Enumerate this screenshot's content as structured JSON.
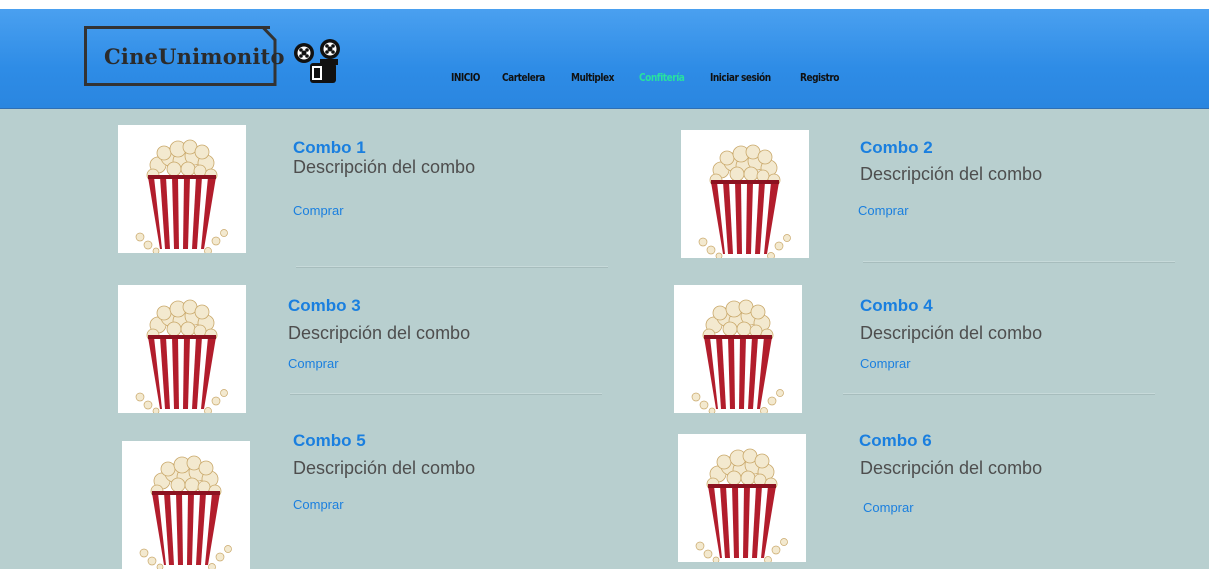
{
  "brand": {
    "name": "CineUnimonito"
  },
  "nav": {
    "items": [
      {
        "label": "INICIO",
        "active": false
      },
      {
        "label": "Cartelera",
        "active": false
      },
      {
        "label": "Multiplex",
        "active": false
      },
      {
        "label": "Confitería",
        "active": true
      },
      {
        "label": "Iniciar sesión",
        "active": false
      },
      {
        "label": "Registro",
        "active": false
      }
    ]
  },
  "combos": [
    {
      "title": "Combo 1",
      "description": "Descripción del combo",
      "buy_label": "Comprar"
    },
    {
      "title": "Combo 2",
      "description": "Descripción del combo",
      "buy_label": "Comprar"
    },
    {
      "title": "Combo 3",
      "description": "Descripción del combo",
      "buy_label": "Comprar"
    },
    {
      "title": "Combo 4",
      "description": "Descripción del combo",
      "buy_label": "Comprar"
    },
    {
      "title": "Combo 5",
      "description": "Descripción del combo",
      "buy_label": "Comprar"
    },
    {
      "title": "Combo 6",
      "description": "Descripción del combo",
      "buy_label": "Comprar"
    }
  ],
  "colors": {
    "header": "#2e8ce6",
    "background": "#b8cfcf",
    "accent": "#1a7fdf",
    "nav_active": "#27e1a0"
  },
  "icons": {
    "logo": "film-projector-icon",
    "combo_image": "popcorn-icon"
  }
}
